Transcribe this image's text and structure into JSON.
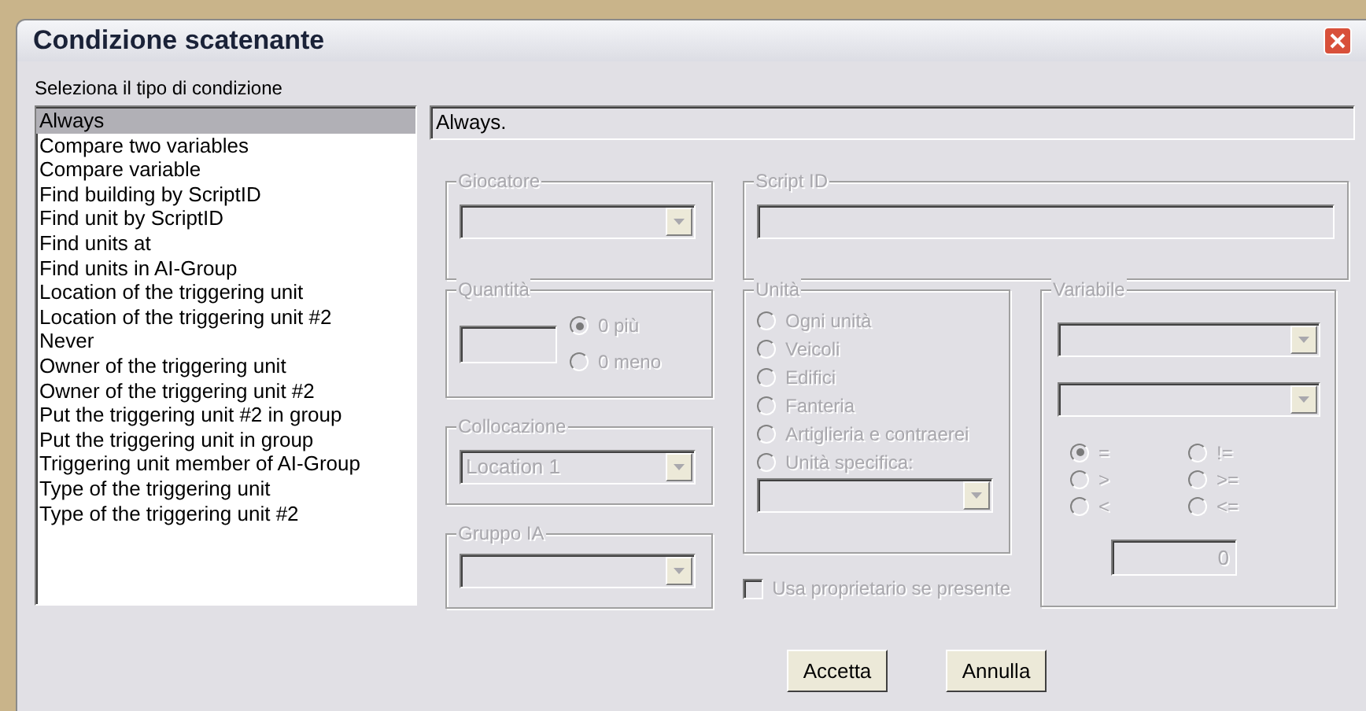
{
  "window": {
    "title": "Condizione scatenante"
  },
  "form_disabled": true,
  "list_label": "Seleziona il tipo di condizione",
  "condition_list": [
    {
      "label": "Always",
      "selected": true
    },
    {
      "label": "Compare two variables",
      "selected": false
    },
    {
      "label": "Compare variable",
      "selected": false
    },
    {
      "label": "Find building by ScriptID",
      "selected": false
    },
    {
      "label": "Find unit by ScriptID",
      "selected": false
    },
    {
      "label": "Find units at",
      "selected": false
    },
    {
      "label": "Find units in AI-Group",
      "selected": false
    },
    {
      "label": "Location of the triggering unit",
      "selected": false
    },
    {
      "label": "Location of the triggering unit #2",
      "selected": false
    },
    {
      "label": "Never",
      "selected": false
    },
    {
      "label": "Owner of the triggering unit",
      "selected": false
    },
    {
      "label": "Owner of the triggering unit #2",
      "selected": false
    },
    {
      "label": "Put the triggering unit #2 in group",
      "selected": false
    },
    {
      "label": "Put the triggering unit in group",
      "selected": false
    },
    {
      "label": "Triggering unit member of AI-Group",
      "selected": false
    },
    {
      "label": "Type of the triggering unit",
      "selected": false
    },
    {
      "label": "Type of the triggering unit #2",
      "selected": false
    }
  ],
  "description": "Always.",
  "giocatore": {
    "label": "Giocatore"
  },
  "script_id": {
    "label": "Script ID"
  },
  "quantita": {
    "label": "Quantità",
    "options": [
      {
        "label": "0 più",
        "selected": true
      },
      {
        "label": "0 meno",
        "selected": false
      }
    ]
  },
  "collocazione": {
    "label": "Collocazione",
    "value": "Location 1"
  },
  "gruppo_ia": {
    "label": "Gruppo IA"
  },
  "unita": {
    "label": "Unità",
    "options": [
      {
        "label": "Ogni unità",
        "selected": false
      },
      {
        "label": "Veicoli",
        "selected": false
      },
      {
        "label": "Edifici",
        "selected": false
      },
      {
        "label": "Fanteria",
        "selected": false
      },
      {
        "label": "Artiglieria e contraerei",
        "selected": false
      },
      {
        "label": "Unità specifica:",
        "selected": false
      }
    ]
  },
  "owner_checkbox": {
    "label": "Usa proprietario se presente",
    "checked": false
  },
  "variabile": {
    "label": "Variabile",
    "operators": [
      {
        "label": "=",
        "selected": true
      },
      {
        "label": "!=",
        "selected": false
      },
      {
        "label": ">",
        "selected": false
      },
      {
        "label": ">=",
        "selected": false
      },
      {
        "label": "<",
        "selected": false
      },
      {
        "label": "<=",
        "selected": false
      }
    ],
    "value": "0"
  },
  "buttons": [
    {
      "label": "Accetta"
    },
    {
      "label": "Annulla"
    }
  ]
}
